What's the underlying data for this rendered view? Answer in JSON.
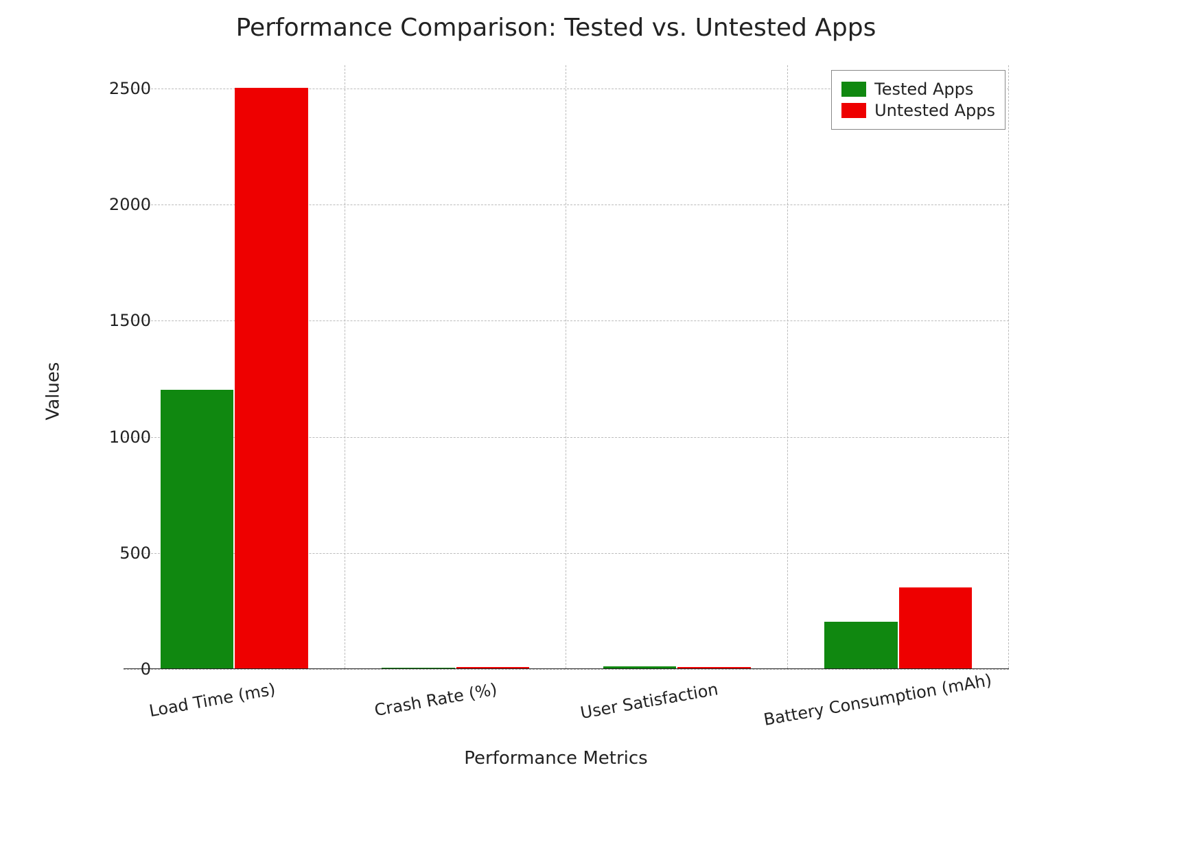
{
  "chart_data": {
    "type": "bar",
    "title": "Performance Comparison: Tested vs. Untested Apps",
    "xlabel": "Performance Metrics",
    "ylabel": "Values",
    "ylim": [
      0,
      2600
    ],
    "categories": [
      "Load Time (ms)",
      "Crash Rate (%)",
      "User Satisfaction",
      "Battery Consumption (mAh)"
    ],
    "series": [
      {
        "name": "Tested Apps",
        "color": "#108810",
        "values": [
          1200,
          2,
          8,
          200
        ]
      },
      {
        "name": "Untested Apps",
        "color": "#ee0000",
        "values": [
          2500,
          5,
          5,
          350
        ]
      }
    ],
    "y_ticks": [
      0,
      500,
      1000,
      1500,
      2000,
      2500
    ]
  }
}
